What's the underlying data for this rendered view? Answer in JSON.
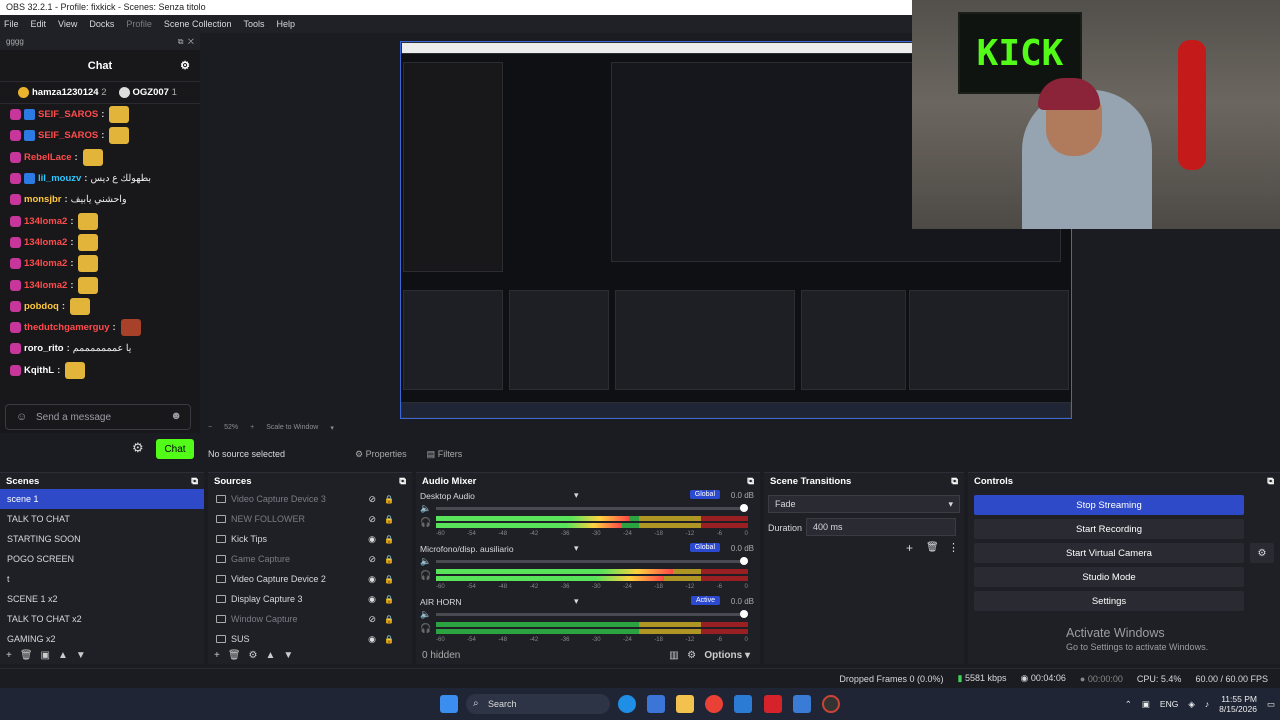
{
  "window": {
    "title": "OBS 32.2.1 - Profile: fixkick - Scenes: Senza titolo"
  },
  "menu": [
    "File",
    "Edit",
    "View",
    "Docks",
    "Profile",
    "Scene Collection",
    "Tools",
    "Help"
  ],
  "chat": {
    "dock_title": "gggg",
    "header": "Chat",
    "pinned": [
      {
        "user": "hamza1230124",
        "count": "2"
      },
      {
        "user": "OGZ007",
        "count": "1"
      }
    ],
    "messages": [
      {
        "user": "SEIF_SAROS",
        "color": "#ff4b4b",
        "text": ""
      },
      {
        "user": "SEIF_SAROS",
        "color": "#ff4b4b",
        "text": ""
      },
      {
        "user": "RebelLace",
        "color": "#ff4b4b",
        "text": ""
      },
      {
        "user": "lil_mouzv",
        "color": "#2dc7ff",
        "text": "بطهولك ع ديس"
      },
      {
        "user": "monsjbr",
        "color": "#ffc83d",
        "text": "واحشني يابيف"
      },
      {
        "user": "134loma2",
        "color": "#ff4b4b",
        "text": ""
      },
      {
        "user": "134loma2",
        "color": "#ff4b4b",
        "text": ""
      },
      {
        "user": "134loma2",
        "color": "#ff4b4b",
        "text": ""
      },
      {
        "user": "134loma2",
        "color": "#ff4b4b",
        "text": ""
      },
      {
        "user": "pobdoq",
        "color": "#ffc83d",
        "text": ""
      },
      {
        "user": "thedutchgamerguy",
        "color": "#ff4b4b",
        "text": ""
      },
      {
        "user": "roro_rito",
        "color": "#ffffff",
        "text": "يا عمممممممم"
      },
      {
        "user": "KqithL",
        "color": "#ffffff",
        "text": ""
      }
    ],
    "input_placeholder": "Send a message",
    "send_label": "Chat"
  },
  "preview": {
    "zoom": "52%",
    "scale_mode": "Scale to Window"
  },
  "webcam": {
    "flag_text": "KICK"
  },
  "propbar": {
    "status": "No source selected",
    "properties": "Properties",
    "filters": "Filters"
  },
  "scenes": {
    "title": "Scenes",
    "items": [
      "scene 1",
      "TALK TO CHAT",
      "STARTING SOON",
      "POGO SCREEN",
      "t",
      "SCENE 1 x2",
      "TALK TO CHAT x2",
      "GAMING x2"
    ]
  },
  "sources": {
    "title": "Sources",
    "items": [
      {
        "name": "Video Capture Device 3",
        "hidden": true
      },
      {
        "name": "NEW FOLLOWER",
        "hidden": true
      },
      {
        "name": "Kick Tips",
        "hidden": false
      },
      {
        "name": "Game Capture",
        "hidden": true
      },
      {
        "name": "Video Capture Device 2",
        "hidden": false
      },
      {
        "name": "Display Capture 3",
        "hidden": false
      },
      {
        "name": "Window Capture",
        "hidden": true
      },
      {
        "name": "SUS",
        "hidden": false
      }
    ]
  },
  "mixer": {
    "title": "Audio Mixer",
    "channels": [
      {
        "name": "Desktop Audio",
        "tag": "Global",
        "db": "0.0 dB",
        "level": 0.62
      },
      {
        "name": "Microfono/disp. ausiliario",
        "tag": "Global",
        "db": "0.0 dB",
        "level": 0.76
      },
      {
        "name": "AIR HORN",
        "tag": "Active",
        "db": "0.0 dB",
        "level": 0.0
      }
    ],
    "scale": [
      "-60",
      "-54",
      "-48",
      "-42",
      "-36",
      "-30",
      "-24",
      "-18",
      "-12",
      "-6",
      "0"
    ],
    "hidden_count": "0 hidden",
    "options": "Options"
  },
  "transitions": {
    "title": "Scene Transitions",
    "type": "Fade",
    "duration_label": "Duration",
    "duration_value": "400 ms"
  },
  "controls": {
    "title": "Controls",
    "buttons": [
      "Stop Streaming",
      "Start Recording",
      "Start Virtual Camera",
      "Studio Mode",
      "Settings"
    ],
    "watermark_title": "Activate Windows",
    "watermark_sub": "Go to Settings to activate Windows."
  },
  "status": {
    "dropped": "Dropped Frames 0 (0.0%)",
    "bitrate": "5581 kbps",
    "stream_time": "00:04:06",
    "rec_time": "00:00:00",
    "cpu": "CPU: 5.4%",
    "fps": "60.00 / 60.00 FPS"
  },
  "taskbar": {
    "search": "Search",
    "lang": "ENG",
    "time": "11:55 PM",
    "date": "8/15/2026"
  }
}
